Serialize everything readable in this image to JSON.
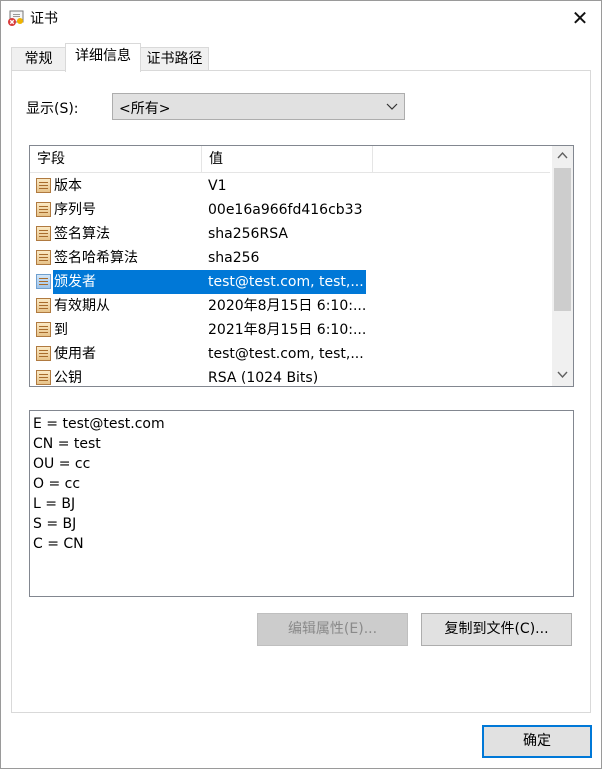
{
  "window": {
    "title": "证书",
    "close_glyph": "✕"
  },
  "tabs": [
    {
      "label": "常规",
      "active": false
    },
    {
      "label": "详细信息",
      "active": true
    },
    {
      "label": "证书路径",
      "active": false
    }
  ],
  "show": {
    "label": "显示(S):",
    "selected": "<所有>"
  },
  "fields_table": {
    "columns": [
      "字段",
      "值"
    ],
    "rows": [
      {
        "field": "版本",
        "value": "V1"
      },
      {
        "field": "序列号",
        "value": "00e16a966fd416cb33"
      },
      {
        "field": "签名算法",
        "value": "sha256RSA"
      },
      {
        "field": "签名哈希算法",
        "value": "sha256"
      },
      {
        "field": "颁发者",
        "value": "test@test.com, test,..."
      },
      {
        "field": "有效期从",
        "value": "2020年8月15日 6:10:..."
      },
      {
        "field": "到",
        "value": "2021年8月15日 6:10:..."
      },
      {
        "field": "使用者",
        "value": "test@test.com, test,..."
      },
      {
        "field": "公钥",
        "value": "RSA (1024 Bits)"
      }
    ],
    "selected_index": 4,
    "row_icon": "certificate-field-icon"
  },
  "detail_lines": [
    "E = test@test.com",
    "CN = test",
    "OU = cc",
    "O = cc",
    "L = BJ",
    "S = BJ",
    "C = CN"
  ],
  "buttons": {
    "edit_properties": "编辑属性(E)...",
    "copy_to_file": "复制到文件(C)...",
    "ok": "确定"
  },
  "colors": {
    "selection": "#0078d7"
  }
}
